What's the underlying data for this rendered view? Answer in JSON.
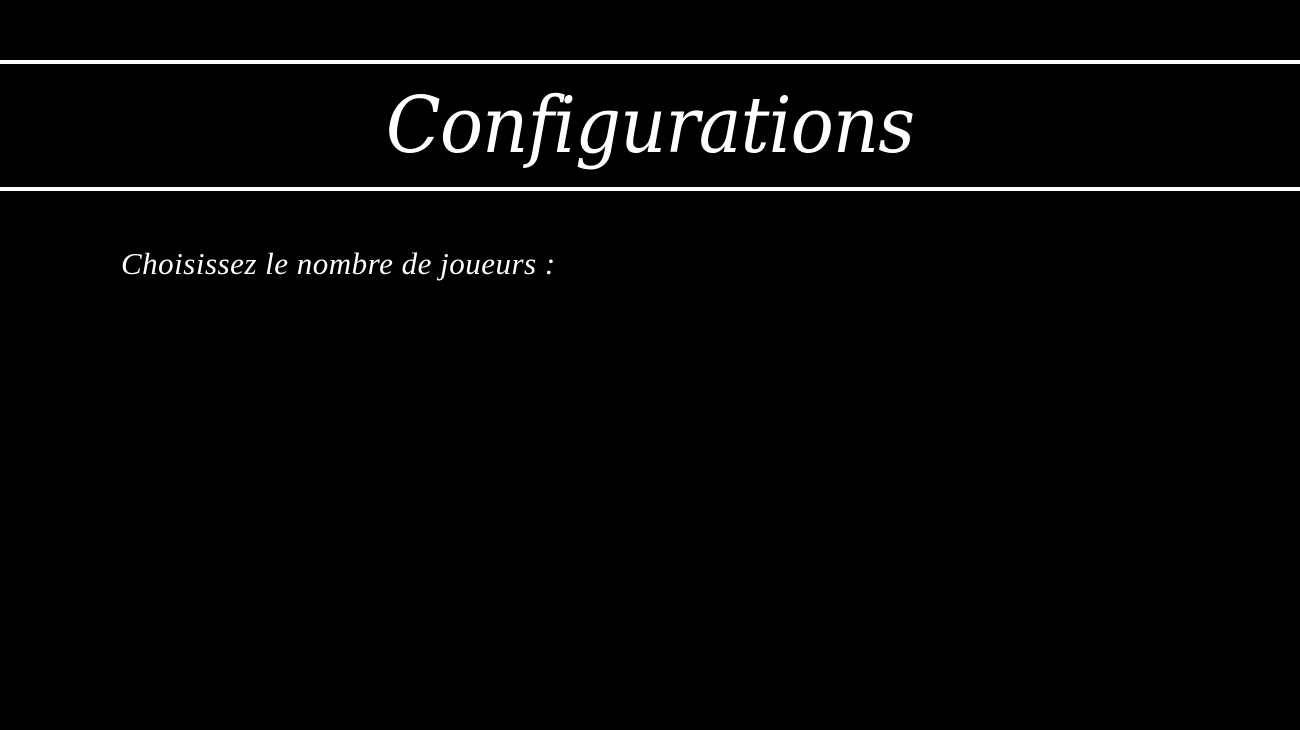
{
  "header": {
    "title": "Configurations"
  },
  "main": {
    "prompt": "Choisissez le nombre de joueurs :"
  },
  "colors": {
    "background": "#000000",
    "foreground": "#ffffff"
  }
}
